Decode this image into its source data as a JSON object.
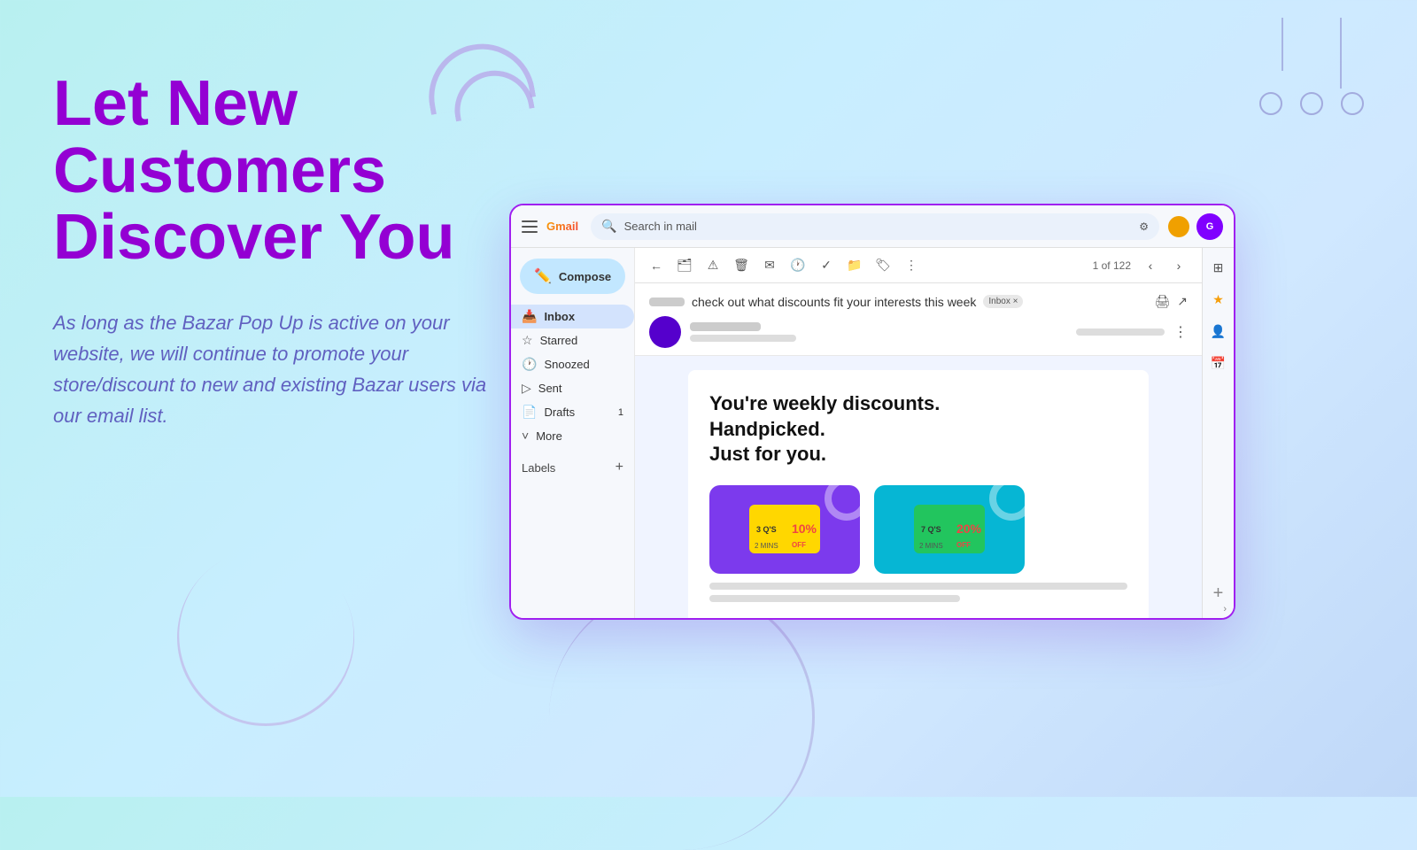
{
  "page": {
    "bg_gradient_start": "#b8f0f0",
    "bg_gradient_end": "#c0d8f8"
  },
  "headline": {
    "line1": "Let New",
    "line2": "Customers",
    "line3": "Discover You"
  },
  "description": "As long as the Bazar Pop Up is active on your website, we will continue to promote your store/discount to new and existing Bazar users via our email list.",
  "gmail": {
    "search_placeholder": "Search in mail",
    "compose_label": "Compose",
    "sidebar_items": [
      {
        "label": "Inbox",
        "icon": "📥",
        "active": true,
        "badge": ""
      },
      {
        "label": "Starred",
        "icon": "☆",
        "active": false,
        "badge": ""
      },
      {
        "label": "Snoozed",
        "icon": "🕐",
        "active": false,
        "badge": ""
      },
      {
        "label": "Sent",
        "icon": "▷",
        "active": false,
        "badge": ""
      },
      {
        "label": "Drafts",
        "icon": "📄",
        "active": false,
        "badge": "1"
      },
      {
        "label": "More",
        "icon": "˅",
        "active": false,
        "badge": ""
      }
    ],
    "labels_label": "Labels",
    "labels_plus": "+",
    "email": {
      "subject": "check out what discounts fit your interests this week",
      "inbox_chip": "Inbox ×",
      "page_count": "1 of 122",
      "card_headline_line1": "You're weekly discounts.",
      "card_headline_line2": "Handpicked.",
      "card_headline_line3": "Just for you.",
      "product1": {
        "qs": "3 Q'S",
        "mins": "2 MINS",
        "discount": "10%",
        "discount_label": "OFF",
        "color": "purple",
        "tag_color": "yellow"
      },
      "product2": {
        "qs": "7 Q'S",
        "mins": "2 MINS",
        "discount": "20%",
        "discount_label": "OFF",
        "color": "cyan",
        "tag_color": "green"
      }
    }
  }
}
